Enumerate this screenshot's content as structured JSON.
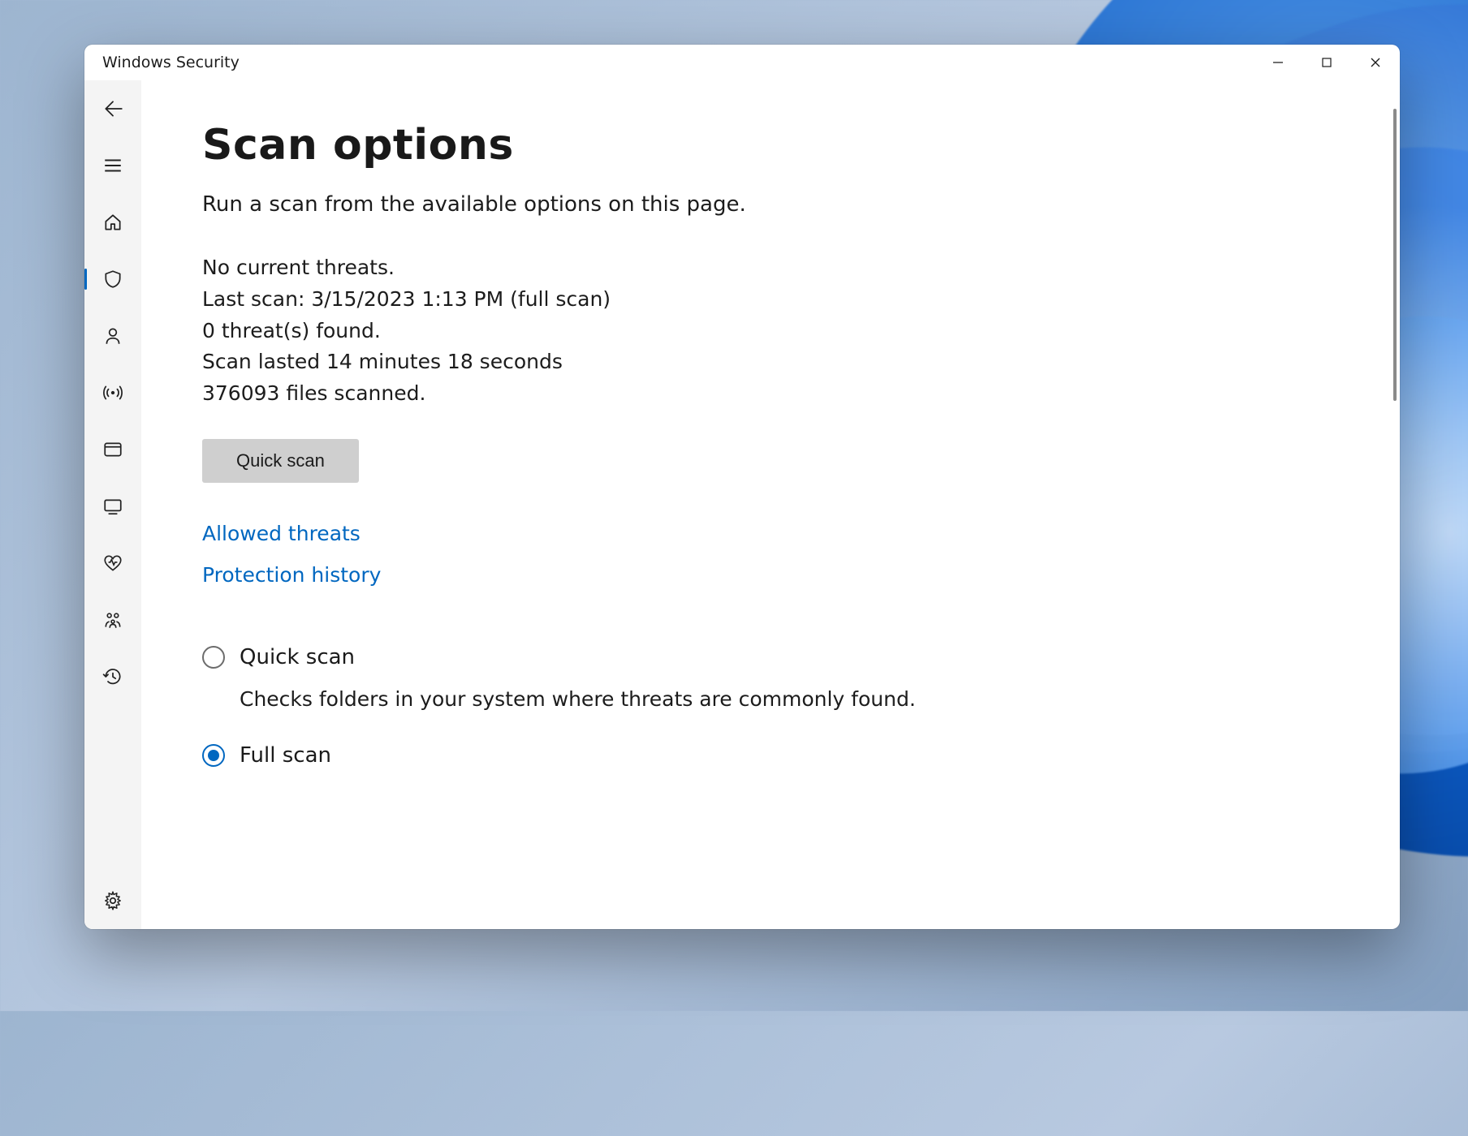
{
  "window": {
    "title": "Windows Security"
  },
  "page": {
    "heading": "Scan options",
    "subheading": "Run a scan from the available options on this page."
  },
  "status": {
    "no_threats": "No current threats.",
    "last_scan": "Last scan: 3/15/2023 1:13 PM (full scan)",
    "threats_found": "0 threat(s) found.",
    "duration": "Scan lasted 14 minutes 18 seconds",
    "files_scanned": "376093 files scanned."
  },
  "buttons": {
    "quick_scan": "Quick scan"
  },
  "links": {
    "allowed_threats": "Allowed threats",
    "protection_history": "Protection history"
  },
  "scan_options": {
    "quick": {
      "label": "Quick scan",
      "desc": "Checks folders in your system where threats are commonly found."
    },
    "full": {
      "label": "Full scan"
    }
  }
}
